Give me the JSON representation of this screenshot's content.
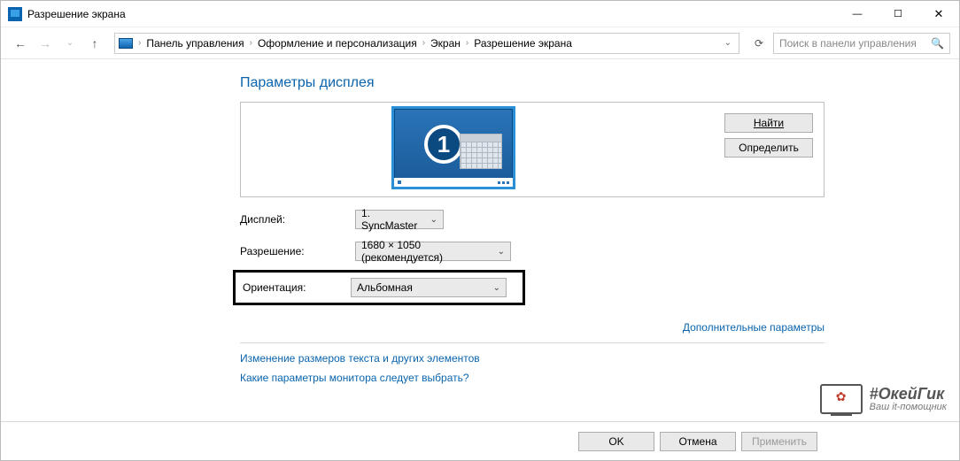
{
  "window": {
    "title": "Разрешение экрана"
  },
  "breadcrumb": {
    "items": [
      "Панель управления",
      "Оформление и персонализация",
      "Экран",
      "Разрешение экрана"
    ]
  },
  "search": {
    "placeholder": "Поиск в панели управления"
  },
  "heading": "Параметры дисплея",
  "preview": {
    "monitor_number": "1",
    "buttons": {
      "find": "Найти",
      "detect": "Определить"
    }
  },
  "form": {
    "display_label": "Дисплей:",
    "display_value": "1. SyncMaster",
    "resolution_label": "Разрешение:",
    "resolution_value": "1680 × 1050 (рекомендуется)",
    "orientation_label": "Ориентация:",
    "orientation_value": "Альбомная"
  },
  "links": {
    "advanced": "Дополнительные параметры",
    "resize_text": "Изменение размеров текста и других элементов",
    "which_settings": "Какие параметры монитора следует выбрать?"
  },
  "footer": {
    "ok": "OK",
    "cancel": "Отмена",
    "apply": "Применить"
  },
  "watermark": {
    "line1": "#ОкейГик",
    "line2": "Ваш it-помощник"
  }
}
